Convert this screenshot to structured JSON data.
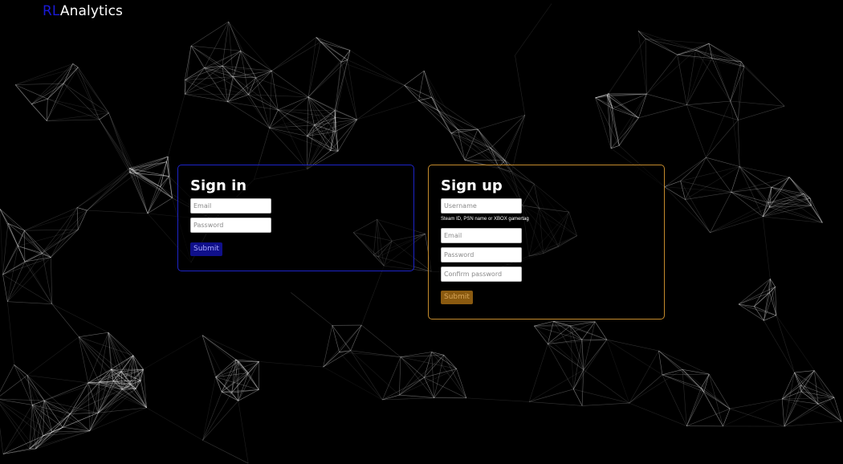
{
  "header": {
    "brand_accent": "RL",
    "brand_rest": "Analytics"
  },
  "signin": {
    "title": "Sign in",
    "email_placeholder": "Email",
    "password_placeholder": "Password",
    "submit_label": "Submit"
  },
  "signup": {
    "title": "Sign up",
    "username_placeholder": "Username",
    "username_hint": "Steam ID, PSN name or XBOX gamertag",
    "email_placeholder": "Email",
    "password_placeholder": "Password",
    "confirm_placeholder": "Confirm password",
    "submit_label": "Submit"
  },
  "colors": {
    "background": "#000000",
    "brand_accent": "#1a1ad8",
    "signin_border": "#1d24c9",
    "signup_border": "#c38a2c",
    "signin_button": "#10108a",
    "signup_button": "#8a5a10"
  }
}
